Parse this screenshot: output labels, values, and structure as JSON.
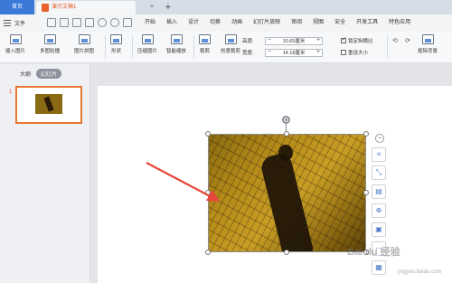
{
  "tabbar": {
    "home_label": "首页",
    "doc_title": "演示文稿1",
    "close_glyph": "×",
    "new_tab_glyph": "+"
  },
  "menubar": {
    "file_label": "文件",
    "tabs": [
      "开始",
      "插入",
      "设计",
      "切换",
      "动画",
      "幻灯片放映",
      "审阅",
      "视图",
      "安全",
      "开发工具",
      "特色应用"
    ],
    "active_tab": "图片工具"
  },
  "ribbon": {
    "buttons": [
      "插入图片",
      "多图轮播",
      "图片拼图",
      "形状",
      "压缩图片",
      "智能缩放",
      "裁剪",
      "创意裁剪",
      "重设大小",
      "抠除背景"
    ],
    "height_label": "高度:",
    "height_value": "10.65厘米",
    "width_label": "宽度:",
    "width_value": "14.18厘米",
    "lock_ratio_label": "锁定纵横比",
    "lock_ratio_checked": true,
    "reset_size_label": "重设大小"
  },
  "leftpanel": {
    "tab_outline": "大纲",
    "tab_slides": "幻灯片",
    "slide_number": "1"
  },
  "canvas": {
    "arrow_color": "#e8483a",
    "selection_color": "#8c8c8c"
  },
  "side_tools": [
    "crop-icon",
    "resize-icon",
    "align-icon",
    "zoom-icon",
    "picture-icon",
    "more-icon",
    "layers-icon"
  ],
  "watermark": {
    "brand": "Bai du 经验",
    "sub": "jingyan.baidu.com"
  }
}
